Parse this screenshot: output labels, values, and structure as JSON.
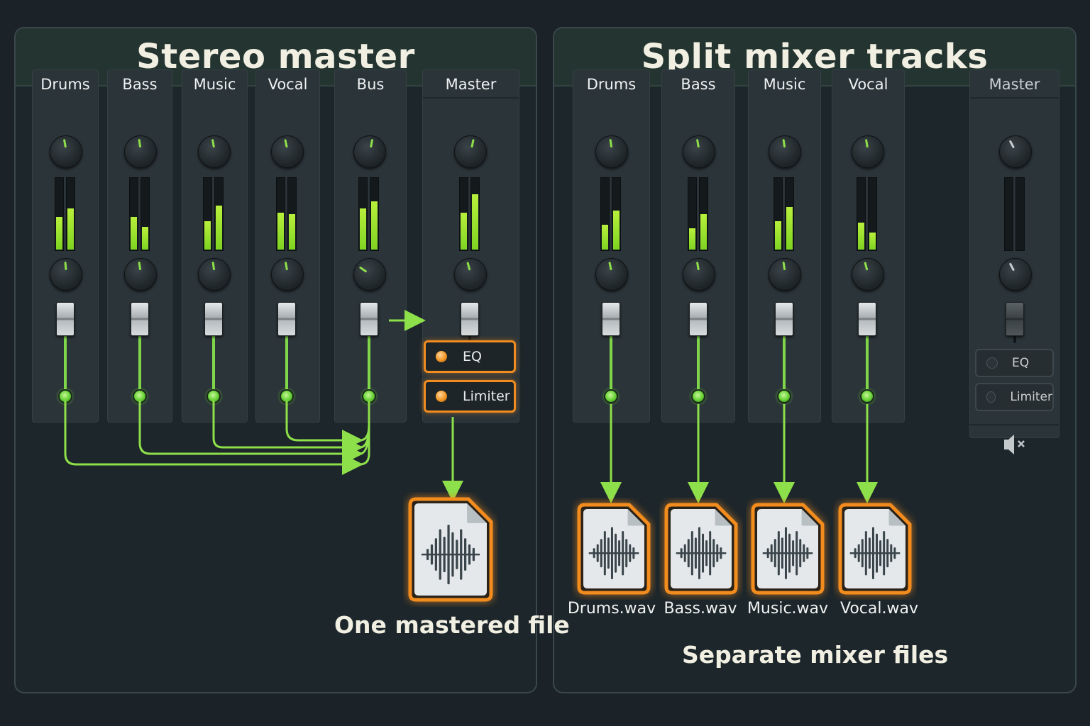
{
  "left_panel": {
    "title": "Stereo master",
    "channels": [
      {
        "label": "Drums"
      },
      {
        "label": "Bass"
      },
      {
        "label": "Music"
      },
      {
        "label": "Vocal"
      },
      {
        "label": "Bus"
      }
    ],
    "master": {
      "label": "Master",
      "plugins": [
        {
          "label": "EQ",
          "active": true
        },
        {
          "label": "Limiter",
          "active": true
        }
      ]
    },
    "caption": "One mastered file"
  },
  "right_panel": {
    "title": "Split mixer tracks",
    "channels": [
      {
        "label": "Drums",
        "file": "Drums.wav"
      },
      {
        "label": "Bass",
        "file": "Bass.wav"
      },
      {
        "label": "Music",
        "file": "Music.wav"
      },
      {
        "label": "Vocal",
        "file": "Vocal.wav"
      }
    ],
    "master": {
      "label": "Master",
      "plugins": [
        {
          "label": "EQ",
          "active": false
        },
        {
          "label": "Limiter",
          "active": false
        }
      ],
      "muted": true
    },
    "caption": "Separate mixer files"
  },
  "icons": {
    "audio_file": "waveform-file-icon",
    "mute": "speaker-muted-icon"
  },
  "colors": {
    "signal": "#8ee04a",
    "highlight": "#f28c1e",
    "background": "#1b2328"
  }
}
